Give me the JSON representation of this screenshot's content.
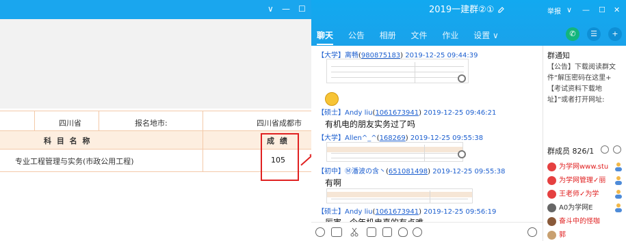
{
  "left_window": {
    "table": {
      "province": "四川省",
      "city_label": "报名地市:",
      "city_value": "四川省成都市",
      "header_subject": "科 目 名 称",
      "header_score": "成 绩",
      "subject": "专业工程管理与实务(市政公用工程)",
      "score": "105"
    },
    "controls": {
      "minimize": "∨",
      "min_dash": "—",
      "maximize": "☐"
    }
  },
  "chat": {
    "group_title": "2019一建群②①",
    "header_report": "举报",
    "controls": {
      "dropdown": "∨",
      "minimize": "—",
      "maximize": "☐",
      "close": "✕"
    },
    "tabs": [
      "聊天",
      "公告",
      "相册",
      "文件",
      "作业",
      "设置 ∨"
    ],
    "messages": [
      {
        "level": "【大学】",
        "nick": "离畅",
        "qq": "980875183",
        "time": "2019-12-25 09:44:39"
      },
      {
        "level": "【硕士】",
        "nick": "Andy liu",
        "qq": "1061673941",
        "time": "2019-12-25 09:46:21",
        "text": "有机电的朋友实务过了吗"
      },
      {
        "level": "【大学】",
        "nick": "Allen^_^",
        "qq": "168269",
        "time": "2019-12-25 09:55:38"
      },
      {
        "level": "【初中】",
        "nick": "Ⓜ潘波の含丶",
        "qq": "651081498",
        "time": "2019-12-25 09:55:38",
        "text": "有啊"
      },
      {
        "level": "【硕士】",
        "nick": "Andy liu",
        "qq": "1061673941",
        "time": "2019-12-25 09:56:19",
        "text": "厉害，今年机电真的有点难"
      }
    ],
    "notice": {
      "title": "群通知",
      "body": "【公告】下载阅读群文件“解压密码在这里+【考试资料下载地址】”或者打开网址:"
    },
    "members": {
      "title": "群成员 826/1",
      "list": [
        {
          "name": "为学网www.stu"
        },
        {
          "name": "为学网管理✓丽"
        },
        {
          "name": "王老师✓为学"
        },
        {
          "name": "A0为学网E"
        },
        {
          "name": "奋斗中的怪咖"
        },
        {
          "name": "郭"
        }
      ]
    }
  }
}
